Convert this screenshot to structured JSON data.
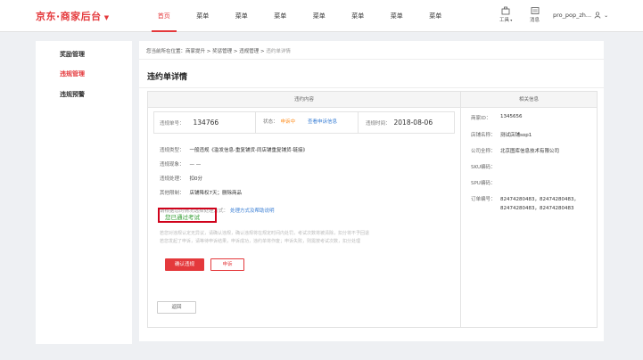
{
  "header": {
    "logo": "京东·商家后台",
    "nav": [
      "首页",
      "菜单",
      "菜单",
      "菜单",
      "菜单",
      "菜单",
      "菜单",
      "菜单"
    ],
    "tools_label": "工具",
    "messages_label": "消息",
    "username": "pro_pop_zh...",
    "accent": "#e4393c"
  },
  "sidebar": {
    "items": [
      {
        "label": "奖励管理"
      },
      {
        "label": "违规管理"
      },
      {
        "label": "违规预警"
      }
    ]
  },
  "breadcrumb": {
    "prefix": "您当前所在位置：",
    "items": [
      "商家提升",
      "奖惩管理",
      "违规管理"
    ],
    "current": "违约单详情",
    "sep": " > "
  },
  "page_title": "违约单详情",
  "columns": {
    "left": "违约内容",
    "right": "相关信息"
  },
  "summary": {
    "id_label": "违规单号：",
    "id_value": "134766",
    "status_label": "状态：",
    "status_value": "申诉中",
    "appeal_link": "查看申诉信息",
    "time_label": "违规时间：",
    "time_value": "2018-08-06"
  },
  "details": {
    "type_label": "违规类型：",
    "type_value": "一般违规《滥发信息-重复铺货-同店铺重复铺货-链接》",
    "phenomenon_label": "违规现象：",
    "phenomenon_value": "— —",
    "handling_label": "违规处理：",
    "handling_value": "扣0分",
    "other_label": "其他限制：",
    "other_value": "店铺降权7天；删除商品",
    "hint_label": "请根据您的情况选择处理方式：",
    "hint_link": "处理方式及帮助说明"
  },
  "passed_text": "您已通过考试",
  "notes": [
    "若您对违规认定无异议，请确认违规，确认违规将在规定时间内处罚，考试次数将被清除，扣分将不予回退",
    "若您发起了申诉，请等待申诉结果，申诉成功，违约单将作废；申诉失败，则需按考试次数，扣分处理"
  ],
  "buttons": {
    "confirm": "确认违规",
    "appeal": "申诉",
    "back": "返回"
  },
  "related": {
    "merchant_id_label": "商家ID：",
    "merchant_id": "1345656",
    "shop_name_label": "店铺名称：",
    "shop_name": "测试店铺sop1",
    "company_label": "公司全称：",
    "company": "北京图库信息技术有限公司",
    "sku_label": "SKU编码：",
    "spu_label": "SPU编码：",
    "order_label": "订单编号：",
    "orders": [
      "82474280483，",
      "82474280483，",
      "82474280483，",
      "82474280483"
    ]
  }
}
